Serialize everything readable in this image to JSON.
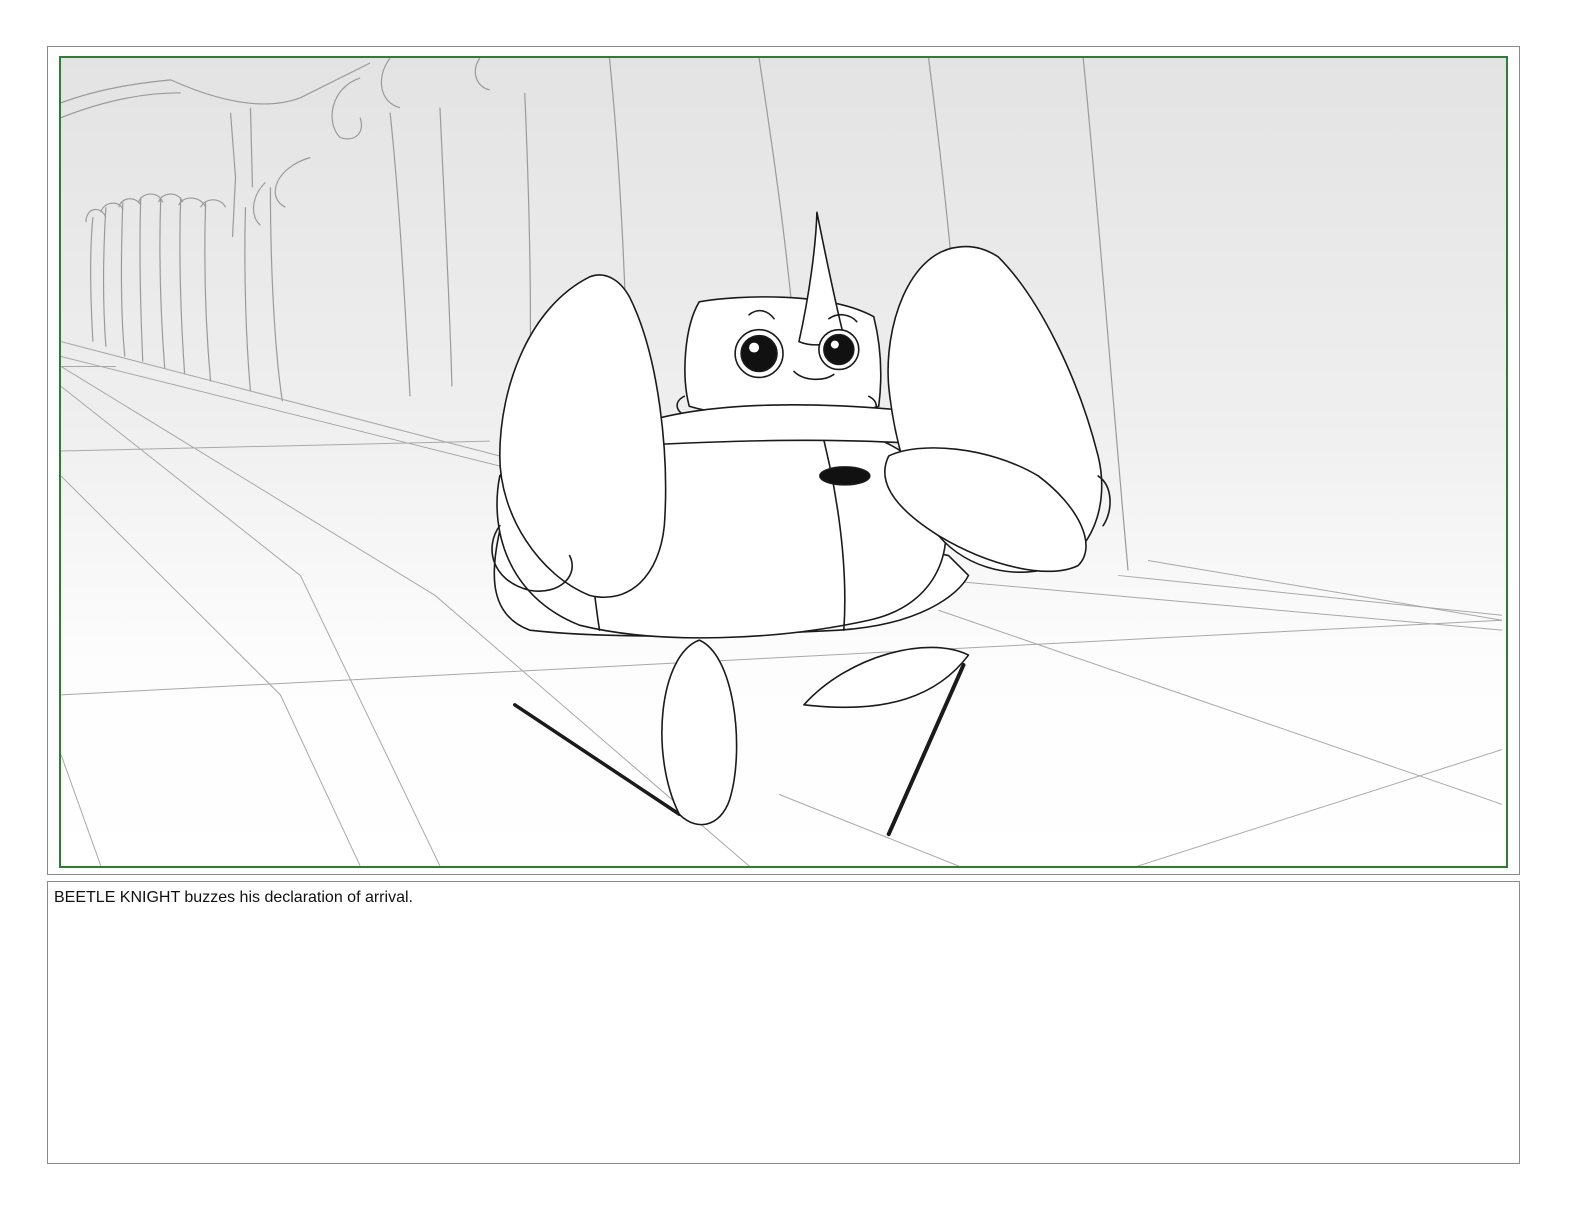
{
  "panel": {
    "frame_color": "#2e7d32",
    "border_color": "#8a8a8a"
  },
  "notes": {
    "text": "BEETLE KNIGHT buzzes his declaration of arrival."
  }
}
